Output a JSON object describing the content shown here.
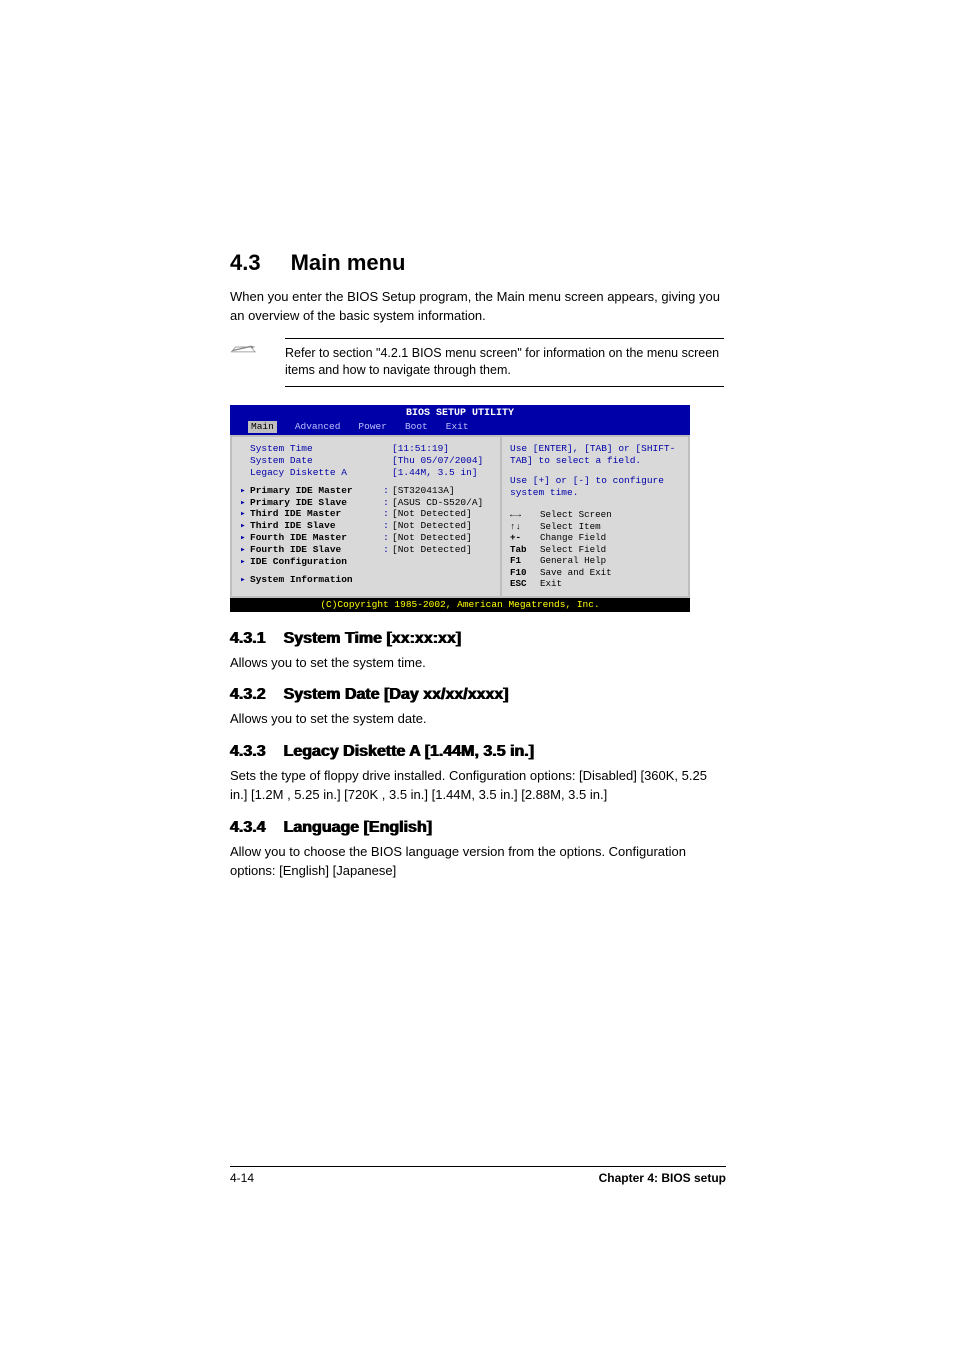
{
  "section": {
    "number": "4.3",
    "title": "Main menu",
    "intro": "When you enter the BIOS Setup program, the Main menu screen appears, giving you an overview of the basic system information.",
    "note": "Refer to section \"4.2.1  BIOS menu screen\" for information on the menu screen items and how to navigate through them."
  },
  "bios": {
    "title": "BIOS SETUP UTILITY",
    "tabs": [
      "Main",
      "Advanced",
      "Power",
      "Boot",
      "Exit"
    ],
    "left_top": [
      {
        "label": "System Time",
        "value": "[11:51:19]"
      },
      {
        "label": "System Date",
        "value": "[Thu 05/07/2004]"
      },
      {
        "label": "Legacy Diskette A",
        "value": "[1.44M, 3.5 in]"
      }
    ],
    "left_sub": [
      {
        "label": "Primary IDE Master",
        "value": "[ST320413A]"
      },
      {
        "label": "Primary IDE Slave",
        "value": "[ASUS CD-S520/A]"
      },
      {
        "label": "Third IDE Master",
        "value": "[Not Detected]"
      },
      {
        "label": "Third IDE Slave",
        "value": "[Not Detected]"
      },
      {
        "label": "Fourth IDE Master",
        "value": "[Not Detected]"
      },
      {
        "label": "Fourth IDE Slave",
        "value": "[Not Detected]"
      },
      {
        "label": "IDE Configuration",
        "value": ""
      }
    ],
    "left_bottom": [
      {
        "label": "System Information",
        "value": ""
      }
    ],
    "right_help1": "Use [ENTER], [TAB] or [SHIFT-TAB] to select a field.",
    "right_help2": "Use [+] or [-] to configure system time.",
    "keys": [
      {
        "k": "←→",
        "d": "Select Screen"
      },
      {
        "k": "↑↓",
        "d": "Select Item"
      },
      {
        "k": "+-",
        "d": "Change Field"
      },
      {
        "k": "Tab",
        "d": "Select Field"
      },
      {
        "k": "F1",
        "d": "General Help"
      },
      {
        "k": "F10",
        "d": "Save and Exit"
      },
      {
        "k": "ESC",
        "d": "Exit"
      }
    ],
    "footer": "(C)Copyright 1985-2002, American Megatrends, Inc."
  },
  "subsections": [
    {
      "num": "4.3.1",
      "title": "System Time [xx:xx:xx]",
      "body": "Allows you to set the system time."
    },
    {
      "num": "4.3.2",
      "title": "System Date [Day xx/xx/xxxx]",
      "body": "Allows you to set the system date."
    },
    {
      "num": "4.3.3",
      "title": "Legacy Diskette A [1.44M, 3.5 in.]",
      "body": "Sets the type of floppy drive installed. Configuration options: [Disabled] [360K, 5.25 in.] [1.2M , 5.25 in.] [720K , 3.5 in.] [1.44M, 3.5 in.] [2.88M, 3.5 in.]"
    },
    {
      "num": "4.3.4",
      "title": "Language [English]",
      "body": "Allow you to choose the BIOS language version from the options. Configuration options: [English] [Japanese]"
    }
  ],
  "footer": {
    "page": "4-14",
    "chapter": "Chapter 4: BIOS setup"
  }
}
